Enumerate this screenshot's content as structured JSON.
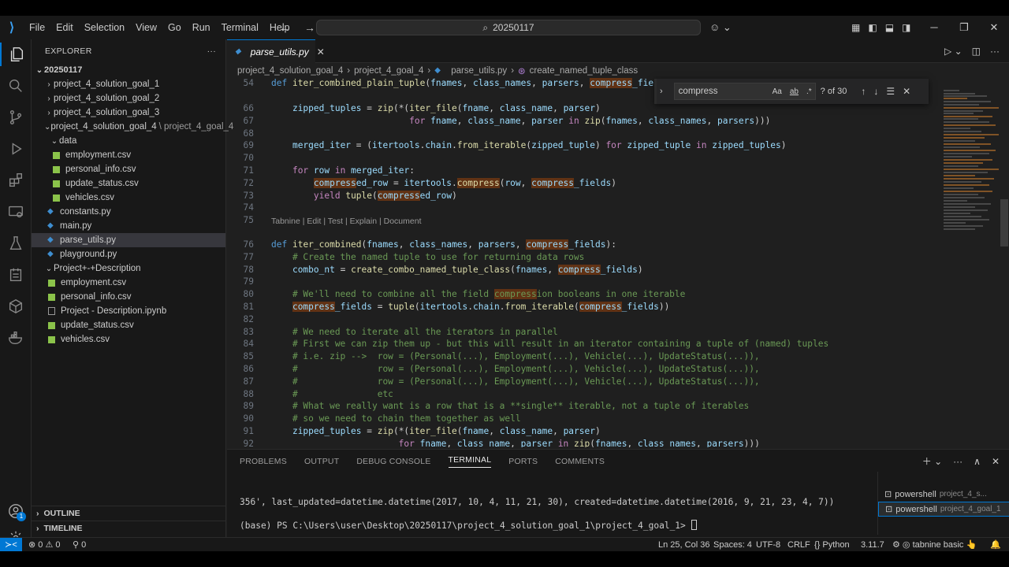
{
  "titlebar": {
    "menu": [
      "File",
      "Edit",
      "Selection",
      "View",
      "Go",
      "Run",
      "Terminal",
      "Help"
    ],
    "search": "20250117"
  },
  "sidebar": {
    "title": "EXPLORER",
    "root": "20250117",
    "items": [
      {
        "label": "project_4_solution_goal_1"
      },
      {
        "label": "project_4_solution_goal_2"
      },
      {
        "label": "project_4_solution_goal_3"
      },
      {
        "label": "project_4_solution_goal_4",
        "suffix": "\\ project_4_goal_4"
      },
      {
        "label": "data"
      },
      {
        "label": "employment.csv"
      },
      {
        "label": "personal_info.csv"
      },
      {
        "label": "update_status.csv"
      },
      {
        "label": "vehicles.csv"
      },
      {
        "label": "constants.py"
      },
      {
        "label": "main.py"
      },
      {
        "label": "parse_utils.py"
      },
      {
        "label": "playground.py"
      },
      {
        "label": "Project+-+Description"
      },
      {
        "label": "employment.csv"
      },
      {
        "label": "personal_info.csv"
      },
      {
        "label": "Project - Description.ipynb"
      },
      {
        "label": "update_status.csv"
      },
      {
        "label": "vehicles.csv"
      }
    ],
    "outline": "OUTLINE",
    "timeline": "TIMELINE"
  },
  "editor": {
    "tab": "parse_utils.py",
    "breadcrumbs": [
      "project_4_solution_goal_4",
      "project_4_goal_4",
      "parse_utils.py",
      "create_named_tuple_class"
    ],
    "codelens": "Tabnine | Edit | Test | Explain | Document",
    "find": {
      "query": "compress",
      "count": "? of 30",
      "opt_case": "Aa",
      "opt_word": "ab",
      "opt_regex": ".*"
    },
    "lines": [
      {
        "n": "54",
        "t": "def iter_combined_plain_tuple(fnames, class_names, parsers, compress_fields):"
      },
      {
        "n": "66",
        "t": "    zipped_tuples = zip(*(iter_file(fname, class_name, parser)"
      },
      {
        "n": "67",
        "t": "                          for fname, class_name, parser in zip(fnames, class_names, parsers)))"
      },
      {
        "n": "68",
        "t": ""
      },
      {
        "n": "69",
        "t": "    merged_iter = (itertools.chain.from_iterable(zipped_tuple) for zipped_tuple in zipped_tuples)"
      },
      {
        "n": "70",
        "t": ""
      },
      {
        "n": "71",
        "t": "    for row in merged_iter:"
      },
      {
        "n": "72",
        "t": "        compressed_row = itertools.compress(row, compress_fields)"
      },
      {
        "n": "73",
        "t": "        yield tuple(compressed_row)"
      },
      {
        "n": "74",
        "t": ""
      },
      {
        "n": "75",
        "t": ""
      },
      {
        "n": "76",
        "t": "def iter_combined(fnames, class_names, parsers, compress_fields):"
      },
      {
        "n": "77",
        "t": "    # Create the named tuple to use for returning data rows"
      },
      {
        "n": "78",
        "t": "    combo_nt = create_combo_named_tuple_class(fnames, compress_fields)"
      },
      {
        "n": "79",
        "t": ""
      },
      {
        "n": "80",
        "t": "    # We'll need to combine all the field compression booleans in one iterable"
      },
      {
        "n": "81",
        "t": "    compress_fields = tuple(itertools.chain.from_iterable(compress_fields))"
      },
      {
        "n": "82",
        "t": ""
      },
      {
        "n": "83",
        "t": "    # We need to iterate all the iterators in parallel"
      },
      {
        "n": "84",
        "t": "    # First we can zip them up - but this will result in an iterator containing a tuple of (named) tuples"
      },
      {
        "n": "85",
        "t": "    # i.e. zip -->  row = (Personal(...), Employment(...), Vehicle(...), UpdateStatus(...)),"
      },
      {
        "n": "86",
        "t": "    #               row = (Personal(...), Employment(...), Vehicle(...), UpdateStatus(...)),"
      },
      {
        "n": "87",
        "t": "    #               row = (Personal(...), Employment(...), Vehicle(...), UpdateStatus(...)),"
      },
      {
        "n": "88",
        "t": "    #               etc"
      },
      {
        "n": "89",
        "t": "    # What we really want is a row that is a **single** iterable, not a tuple of iterables"
      },
      {
        "n": "90",
        "t": "    # so we need to chain them together as well"
      },
      {
        "n": "91",
        "t": "    zipped_tuples = zip(*(iter_file(fname, class_name, parser)"
      },
      {
        "n": "92",
        "t": "                        for fname, class_name, parser in zip(fnames, class_names, parsers)))"
      }
    ]
  },
  "panel": {
    "tabs": [
      "PROBLEMS",
      "OUTPUT",
      "DEBUG CONSOLE",
      "TERMINAL",
      "PORTS",
      "COMMENTS"
    ],
    "active_tab": "TERMINAL",
    "line1": "356', last_updated=datetime.datetime(2017, 10, 4, 11, 21, 30), created=datetime.datetime(2016, 9, 21, 23, 4, 7))",
    "line2": "(base) PS C:\\Users\\user\\Desktop\\20250117\\project_4_solution_goal_1\\project_4_goal_1> ",
    "terminals": [
      {
        "name": "powershell",
        "detail": "project_4_s..."
      },
      {
        "name": "powershell",
        "detail": "project_4_goal_1"
      }
    ]
  },
  "status": {
    "errors": "0",
    "warnings": "0",
    "ports": "0",
    "position": "Ln 25, Col 36",
    "spaces": "Spaces: 4",
    "encoding": "UTF-8",
    "eol": "CRLF",
    "language": "Python",
    "version": "3.11.7",
    "tabnine": "tabnine basic"
  },
  "colors": {
    "accent": "#0078d4",
    "find_highlight": "#ea5c00",
    "csv_icon": "#8bc34a"
  }
}
